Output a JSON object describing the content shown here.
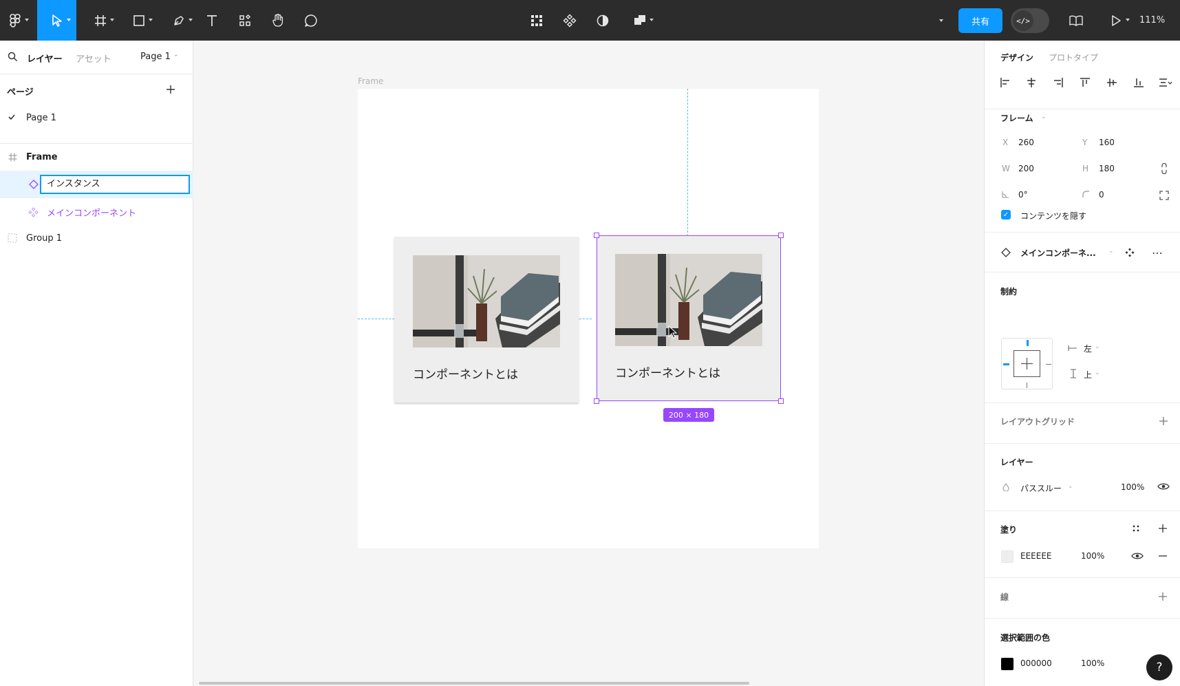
{
  "toolbar": {
    "share_label": "共有",
    "dev_mode_label": "</>",
    "zoom": "111%"
  },
  "left_panel": {
    "tabs": {
      "layers": "レイヤー",
      "assets": "アセット",
      "page_select": "Page 1"
    },
    "pages_title": "ページ",
    "pages": [
      "Page 1"
    ],
    "layers": {
      "frame": "Frame",
      "instance": "インスタンス",
      "main_component": "メインコンポーネント",
      "group": "Group 1"
    }
  },
  "canvas": {
    "frame_label": "Frame",
    "cards": [
      {
        "title": "コンポーネントとは"
      },
      {
        "title": "コンポーネントとは"
      }
    ],
    "selection_size": "200 × 180"
  },
  "right_panel": {
    "tabs": {
      "design": "デザイン",
      "prototype": "プロトタイプ"
    },
    "frame_section": {
      "title": "フレーム",
      "x_label": "X",
      "x": "260",
      "y_label": "Y",
      "y": "160",
      "w_label": "W",
      "w": "200",
      "h_label": "H",
      "h": "180",
      "rotation": "0°",
      "radius": "0",
      "clip_content_label": "コンテンツを隠す"
    },
    "component": {
      "name": "メインコンポーネ..."
    },
    "constraints": {
      "title": "制約",
      "horizontal": "左",
      "vertical": "上"
    },
    "layout_grid": {
      "title": "レイアウトグリッド"
    },
    "layer": {
      "title": "レイヤー",
      "blend": "パススルー",
      "opacity": "100%"
    },
    "fill": {
      "title": "塗り",
      "hex": "EEEEEE",
      "opacity": "100%",
      "color": "#EEEEEE"
    },
    "stroke": {
      "title": "線"
    },
    "selection_colors": {
      "title": "選択範囲の色",
      "hex": "000000",
      "opacity": "100%",
      "color": "#000000"
    }
  },
  "help_label": "?"
}
